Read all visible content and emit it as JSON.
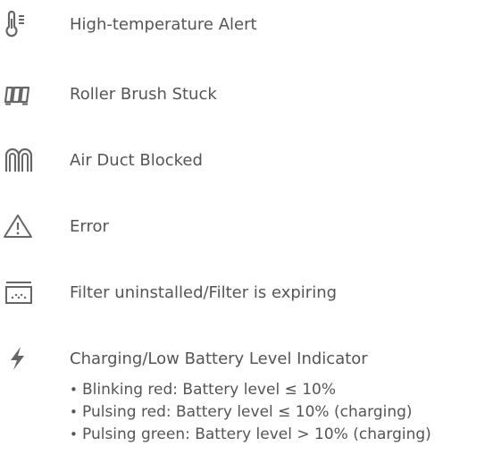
{
  "items": [
    {
      "icon": "thermometer-alert-icon",
      "label": "High-temperature Alert"
    },
    {
      "icon": "roller-brush-icon",
      "label": "Roller Brush Stuck"
    },
    {
      "icon": "air-duct-icon",
      "label": "Air Duct Blocked"
    },
    {
      "icon": "warning-triangle-icon",
      "label": "Error"
    },
    {
      "icon": "filter-icon",
      "label": "Filter uninstalled/Filter is expiring"
    },
    {
      "icon": "lightning-bolt-icon",
      "label": "Charging/Low Battery Level Indicator"
    }
  ],
  "battery_notes": [
    "Blinking red: Battery level ≤ 10%",
    "Pulsing red: Battery level ≤ 10% (charging)",
    "Pulsing green: Battery level > 10% (charging)"
  ],
  "colors": {
    "text": "#555555",
    "icon": "#666666"
  }
}
